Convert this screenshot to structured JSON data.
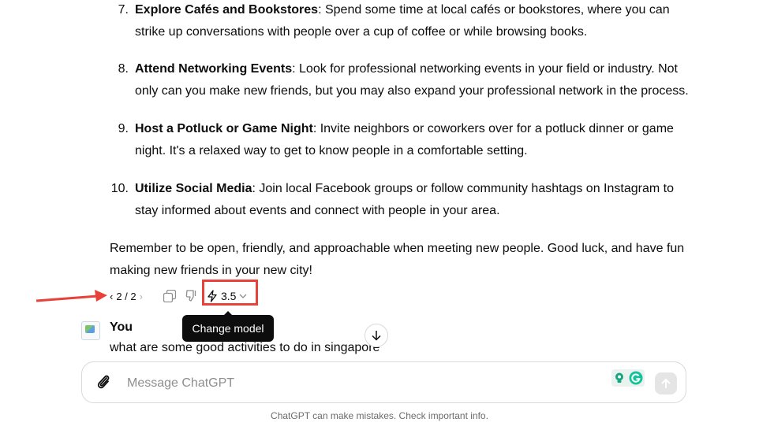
{
  "list_items": [
    {
      "number": "7.",
      "title": "Explore Cafés and Bookstores",
      "text": ": Spend some time at local cafés or bookstores, where you can strike up conversations with people over a cup of coffee or while browsing books."
    },
    {
      "number": "8.",
      "title": "Attend Networking Events",
      "text": ": Look for professional networking events in your field or industry. Not only can you make new friends, but you may also expand your professional network in the process."
    },
    {
      "number": "9.",
      "title": "Host a Potluck or Game Night",
      "text": ": Invite neighbors or coworkers over for a potluck dinner or game night. It's a relaxed way to get to know people in a comfortable setting."
    },
    {
      "number": "10.",
      "title": "Utilize Social Media",
      "text": ": Join local Facebook groups or follow community hashtags on Instagram to stay informed about events and connect with people in your area."
    }
  ],
  "closing_paragraph": "Remember to be open, friendly, and approachable when meeting new people. Good luck, and have fun making new friends in your new city!",
  "actions": {
    "pager": "2 / 2",
    "model_label": "3.5",
    "tooltip": "Change model",
    "icons": [
      "chevron-left-icon",
      "chevron-right-icon",
      "copy-icon",
      "thumbs-down-icon",
      "lightning-icon",
      "chevron-down-icon"
    ]
  },
  "user_message": {
    "author": "You",
    "text": "what are some good activities to do in singapore"
  },
  "composer": {
    "placeholder": "Message ChatGPT"
  },
  "footer_note": "ChatGPT can make mistakes. Check important info.",
  "colors": {
    "highlight": "#e8413a",
    "annotation_arrow": "#e8413a",
    "tooltip_bg": "#0d0d0d"
  }
}
